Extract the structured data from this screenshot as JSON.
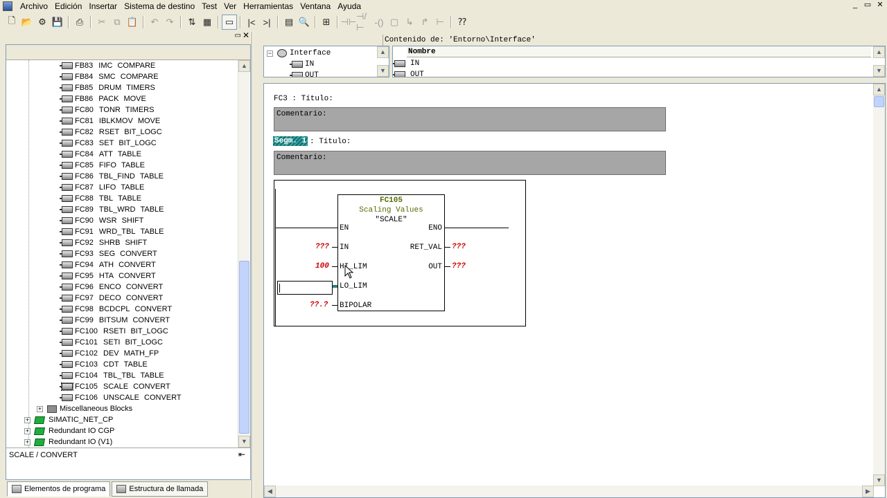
{
  "menu": [
    "Archivo",
    "Edición",
    "Insertar",
    "Sistema de destino",
    "Test",
    "Ver",
    "Herramientas",
    "Ventana",
    "Ayuda"
  ],
  "window_controls": [
    "_",
    "▭",
    "✕"
  ],
  "toolbar_icons": [
    "new-icon",
    "open-icon",
    "accessible-nodes-icon",
    "save-icon",
    "print-icon",
    "cut-icon",
    "copy-icon",
    "paste-icon",
    "undo-icon",
    "redo-icon",
    "load-icon",
    "monitor-icon",
    "overview-icon",
    "first-icon",
    "last-icon",
    "layout-icon",
    "zoom-icon",
    "contacts-icon",
    "no-contact-icon",
    "nc-contact-icon",
    "coil-icon",
    "branch-open-icon",
    "branch-close-icon",
    "jump-icon",
    "help-icon"
  ],
  "tree": {
    "items": [
      {
        "code": "FB83",
        "name": "IMC",
        "cat": "COMPARE"
      },
      {
        "code": "FB84",
        "name": "SMC",
        "cat": "COMPARE"
      },
      {
        "code": "FB85",
        "name": "DRUM",
        "cat": "TIMERS"
      },
      {
        "code": "FB86",
        "name": "PACK",
        "cat": "MOVE"
      },
      {
        "code": "FC80",
        "name": "TONR",
        "cat": "TIMERS"
      },
      {
        "code": "FC81",
        "name": "IBLKMOV",
        "cat": "MOVE"
      },
      {
        "code": "FC82",
        "name": "RSET",
        "cat": "BIT_LOGC"
      },
      {
        "code": "FC83",
        "name": "SET",
        "cat": "BIT_LOGC"
      },
      {
        "code": "FC84",
        "name": "ATT",
        "cat": "TABLE"
      },
      {
        "code": "FC85",
        "name": "FIFO",
        "cat": "TABLE"
      },
      {
        "code": "FC86",
        "name": "TBL_FIND",
        "cat": "TABLE"
      },
      {
        "code": "FC87",
        "name": "LIFO",
        "cat": "TABLE"
      },
      {
        "code": "FC88",
        "name": "TBL",
        "cat": "TABLE"
      },
      {
        "code": "FC89",
        "name": "TBL_WRD",
        "cat": "TABLE"
      },
      {
        "code": "FC90",
        "name": "WSR",
        "cat": "SHIFT"
      },
      {
        "code": "FC91",
        "name": "WRD_TBL",
        "cat": "TABLE"
      },
      {
        "code": "FC92",
        "name": "SHRB",
        "cat": "SHIFT"
      },
      {
        "code": "FC93",
        "name": "SEG",
        "cat": "CONVERT"
      },
      {
        "code": "FC94",
        "name": "ATH",
        "cat": "CONVERT"
      },
      {
        "code": "FC95",
        "name": "HTA",
        "cat": "CONVERT"
      },
      {
        "code": "FC96",
        "name": "ENCO",
        "cat": "CONVERT"
      },
      {
        "code": "FC97",
        "name": "DECO",
        "cat": "CONVERT"
      },
      {
        "code": "FC98",
        "name": "BCDCPL",
        "cat": "CONVERT"
      },
      {
        "code": "FC99",
        "name": "BITSUM",
        "cat": "CONVERT"
      },
      {
        "code": "FC100",
        "name": "RSETI",
        "cat": "BIT_LOGC"
      },
      {
        "code": "FC101",
        "name": "SETI",
        "cat": "BIT_LOGC"
      },
      {
        "code": "FC102",
        "name": "DEV",
        "cat": "MATH_FP"
      },
      {
        "code": "FC103",
        "name": "CDT",
        "cat": "TABLE"
      },
      {
        "code": "FC104",
        "name": "TBL_TBL",
        "cat": "TABLE"
      },
      {
        "code": "FC105",
        "name": "SCALE",
        "cat": "CONVERT"
      },
      {
        "code": "FC106",
        "name": "UNSCALE",
        "cat": "CONVERT"
      }
    ],
    "folders": [
      "Miscellaneous Blocks"
    ],
    "libraries": [
      "SIMATIC_NET_CP",
      "Redundant IO CGP",
      "Redundant IO (V1)"
    ],
    "status_text": "SCALE / CONVERT"
  },
  "tabs": [
    "Elementos de programa",
    "Estructura de llamada"
  ],
  "interface": {
    "path_label": "Contenido de:",
    "path_value": "'Entorno\\Interface'",
    "root": "Interface",
    "children": [
      "IN",
      "OUT"
    ],
    "table_header": "Nombre",
    "table_rows": [
      "IN",
      "OUT"
    ]
  },
  "editor": {
    "block_title": "FC3 : Título:",
    "comment_label": "Comentario:",
    "segment_label": "Segm. 1",
    "segment_title": ": Título:",
    "segment_comment": "Comentario:",
    "fc_name": "FC105",
    "fc_desc": "Scaling Values",
    "fc_symbol": "\"SCALE\"",
    "pins_left": [
      "EN",
      "IN",
      "HI_LIM",
      "LO_LIM",
      "BIPOLAR"
    ],
    "pins_right": [
      "ENO",
      "RET_VAL",
      "OUT"
    ],
    "in_value": "???",
    "hilim_value": "100",
    "bipolar_value": "??.?",
    "retval_value": "???",
    "out_value": "???"
  }
}
